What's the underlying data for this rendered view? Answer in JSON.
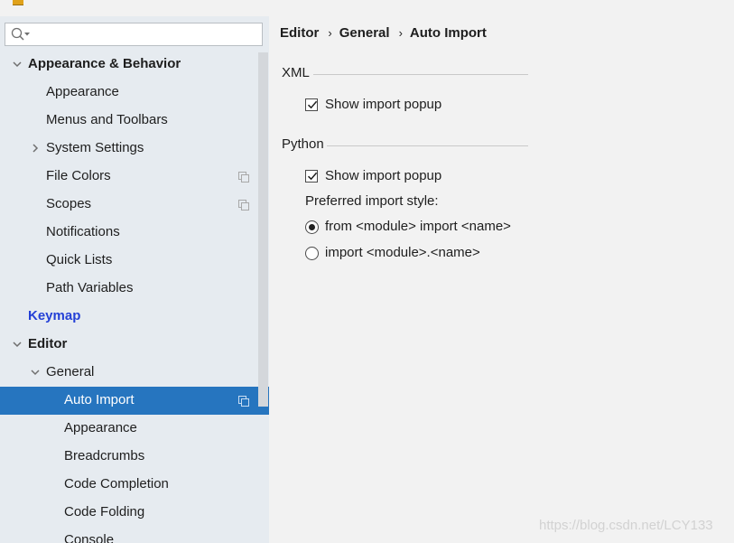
{
  "search": {
    "placeholder": "",
    "value": ""
  },
  "tree": [
    {
      "label": "Appearance & Behavior",
      "bold": true,
      "expanded": true,
      "arrow": "down",
      "copy": false
    },
    {
      "label": "Appearance",
      "copy": false
    },
    {
      "label": "Menus and Toolbars",
      "copy": false
    },
    {
      "label": "System Settings",
      "arrow": "right",
      "copy": false
    },
    {
      "label": "File Colors",
      "copy": true
    },
    {
      "label": "Scopes",
      "copy": true
    },
    {
      "label": "Notifications",
      "copy": false
    },
    {
      "label": "Quick Lists",
      "copy": false
    },
    {
      "label": "Path Variables",
      "copy": false
    },
    {
      "label": "Keymap",
      "bold": true,
      "link": true,
      "copy": false
    },
    {
      "label": "Editor",
      "bold": true,
      "arrow": "down",
      "copy": false
    },
    {
      "label": "General",
      "arrow": "down",
      "copy": false
    },
    {
      "label": "Auto Import",
      "selected": true,
      "copy": true
    },
    {
      "label": "Appearance",
      "copy": false
    },
    {
      "label": "Breadcrumbs",
      "copy": false
    },
    {
      "label": "Code Completion",
      "copy": false
    },
    {
      "label": "Code Folding",
      "copy": false
    },
    {
      "label": "Console",
      "copy": false
    }
  ],
  "breadcrumb": {
    "items": [
      "Editor",
      "General",
      "Auto Import"
    ],
    "separator": "›"
  },
  "xml": {
    "title": "XML",
    "show_import_popup": {
      "label": "Show import popup",
      "checked": true
    }
  },
  "python": {
    "title": "Python",
    "show_import_popup": {
      "label": "Show import popup",
      "checked": true
    },
    "preferred_style_label": "Preferred import style:",
    "options": [
      {
        "label": "from <module> import <name>",
        "selected": true
      },
      {
        "label": "import <module>.<name>",
        "selected": false
      }
    ]
  },
  "watermark": "https://blog.csdn.net/LCY133",
  "colors": {
    "selection": "#2675bf",
    "link": "#2440d6",
    "sidebar_bg": "#e6ebf0",
    "content_bg": "#f2f2f2"
  }
}
